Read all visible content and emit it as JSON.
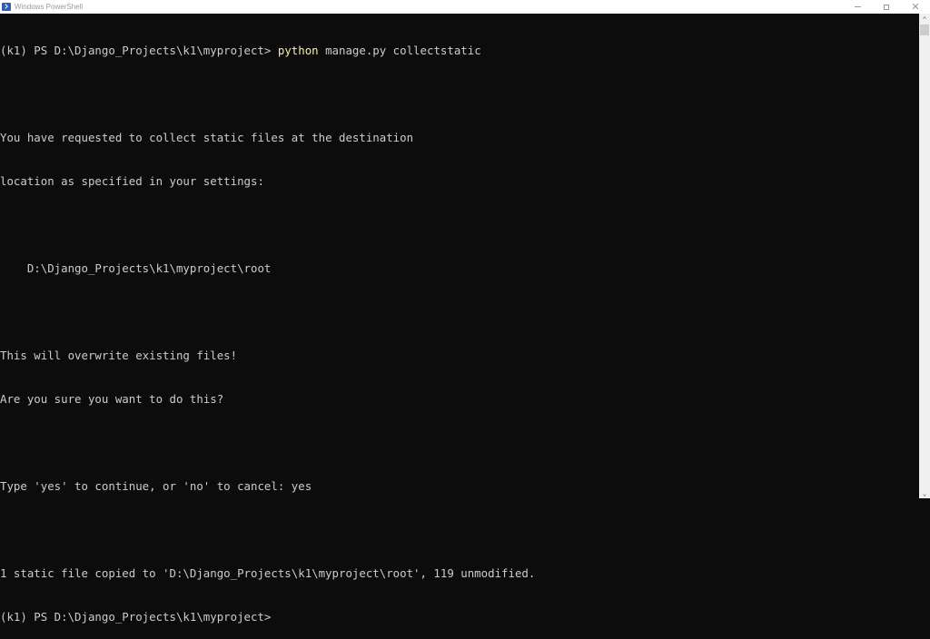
{
  "window": {
    "title": "Windows PowerShell",
    "app_icon": "powershell-icon",
    "controls": {
      "minimize": "minimize-icon",
      "maximize": "maximize-icon",
      "close_glyph": "✕"
    }
  },
  "console": {
    "colors": {
      "background": "#0c0c0c",
      "foreground": "#cccccc",
      "command": "#f9f1a5"
    },
    "lines": [
      {
        "prompt": "(k1) PS D:\\Django_Projects\\k1\\myproject> ",
        "command": "python",
        "args": " manage.py collectstatic"
      },
      {
        "text": ""
      },
      {
        "text": "You have requested to collect static files at the destination"
      },
      {
        "text": "location as specified in your settings:"
      },
      {
        "text": ""
      },
      {
        "text": "    D:\\Django_Projects\\k1\\myproject\\root"
      },
      {
        "text": ""
      },
      {
        "text": "This will overwrite existing files!"
      },
      {
        "text": "Are you sure you want to do this?"
      },
      {
        "text": ""
      },
      {
        "text": "Type 'yes' to continue, or 'no' to cancel: yes"
      },
      {
        "text": ""
      },
      {
        "text": "1 static file copied to 'D:\\Django_Projects\\k1\\myproject\\root', 119 unmodified."
      },
      {
        "prompt": "(k1) PS D:\\Django_Projects\\k1\\myproject>"
      }
    ]
  },
  "scrollbar": {
    "up_glyph": "⌃",
    "down_glyph": "⌄",
    "position_fraction": 0.0
  }
}
